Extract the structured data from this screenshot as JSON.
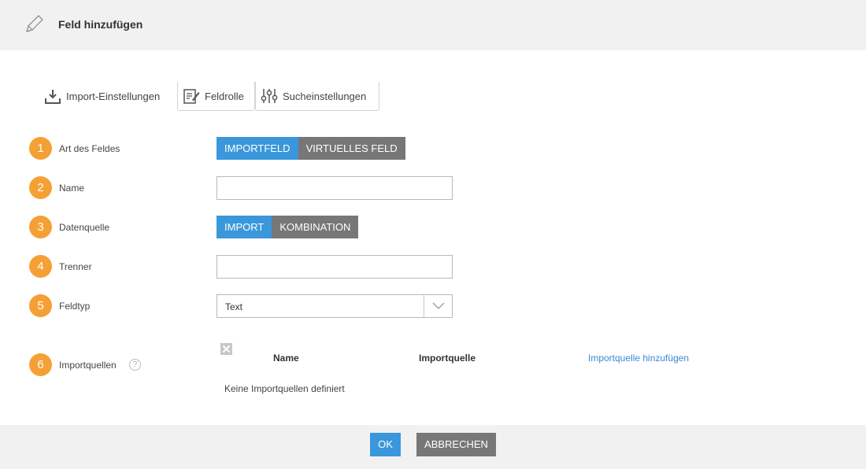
{
  "header": {
    "title": "Feld hinzufügen",
    "icon": "pencil-icon"
  },
  "tabs": [
    {
      "label": "Import-Einstellungen",
      "icon": "download-icon"
    },
    {
      "label": "Feldrolle",
      "icon": "edit-document-icon"
    },
    {
      "label": "Sucheinstellungen",
      "icon": "sliders-icon"
    }
  ],
  "form": {
    "field_type": {
      "number": "1",
      "label": "Art des Feldes",
      "options": [
        "IMPORTFELD",
        "VIRTUELLES FELD"
      ],
      "selected": "IMPORTFELD"
    },
    "name": {
      "number": "2",
      "label": "Name",
      "value": ""
    },
    "data_source": {
      "number": "3",
      "label": "Datenquelle",
      "options": [
        "IMPORT",
        "KOMBINATION"
      ],
      "selected": "IMPORT"
    },
    "separator": {
      "number": "4",
      "label": "Trenner",
      "value": ""
    },
    "data_type": {
      "number": "5",
      "label": "Feldtyp",
      "selected": "Text"
    },
    "import_sources": {
      "number": "6",
      "label": "Importquellen",
      "help_glyph": "?",
      "columns": [
        "Name",
        "Importquelle"
      ],
      "add_link": "Importquelle hinzufügen",
      "empty_text": "Keine Importquellen definiert"
    }
  },
  "footer": {
    "ok_label": "OK",
    "cancel_label": "ABBRECHEN"
  },
  "colors": {
    "accent": "#3a97db",
    "neutral": "#777777",
    "badge": "#f5a034",
    "link": "#3a8ad4"
  }
}
